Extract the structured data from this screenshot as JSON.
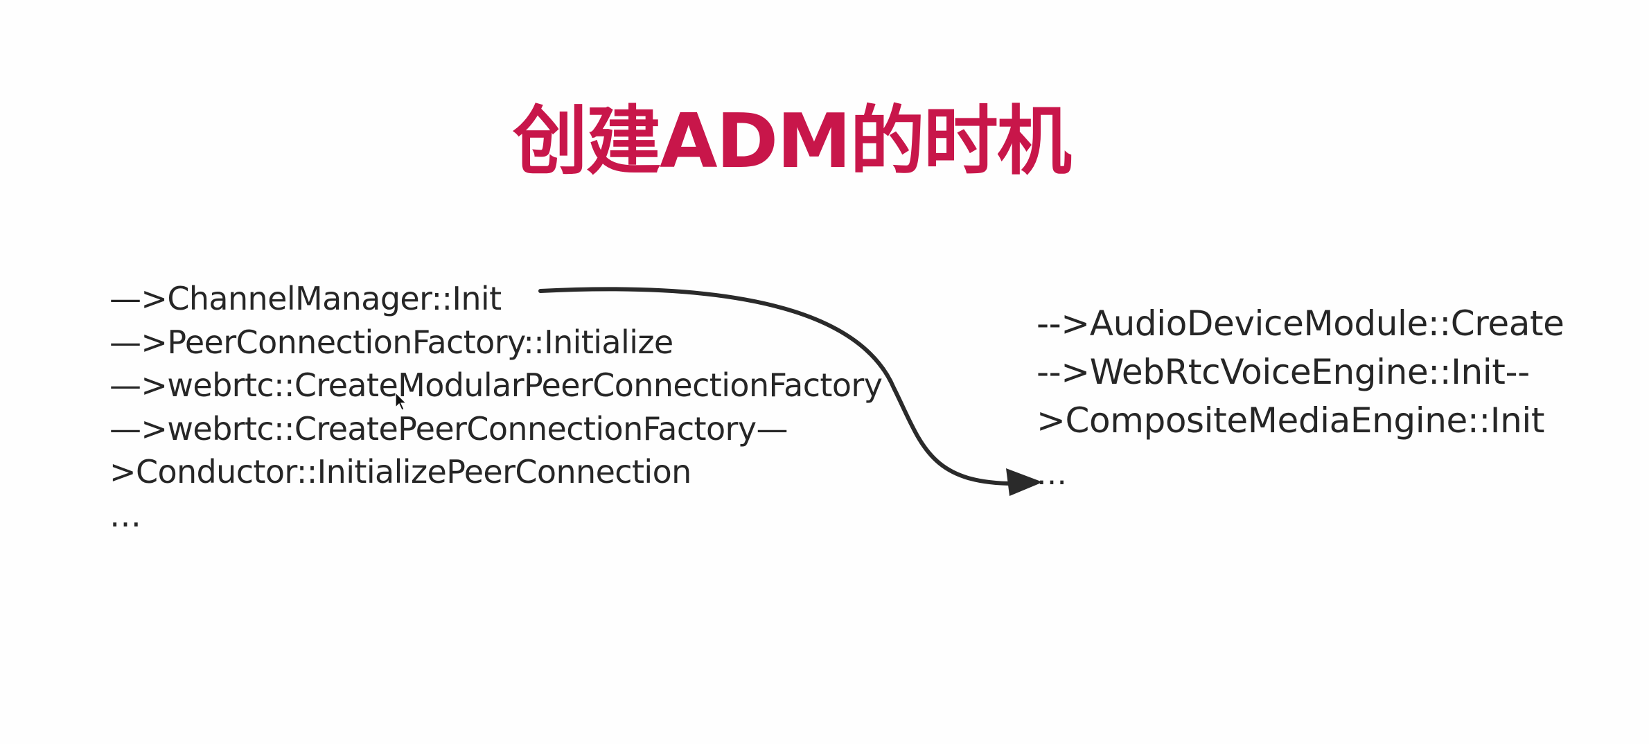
{
  "slide": {
    "title": "创建ADM的时机",
    "colors": {
      "title": "#c8164a",
      "text": "#262626",
      "arrow": "#2a2a2a",
      "background": "#fefefe"
    },
    "left_lines": [
      "—>ChannelManager::Init",
      "—>PeerConnectionFactory::Initialize",
      "—>webrtc::CreateModularPeerConnectionFactory",
      "—>webrtc::CreatePeerConnectionFactory—",
      ">Conductor::InitializePeerConnection",
      "…"
    ],
    "right_lines": [
      "-->AudioDeviceModule::Create",
      "-->WebRtcVoiceEngine::Init--",
      ">CompositeMediaEngine::Init",
      "…"
    ]
  },
  "icons": {
    "flow_arrow": "curved-arrow-icon",
    "cursor": "mouse-pointer-icon"
  }
}
